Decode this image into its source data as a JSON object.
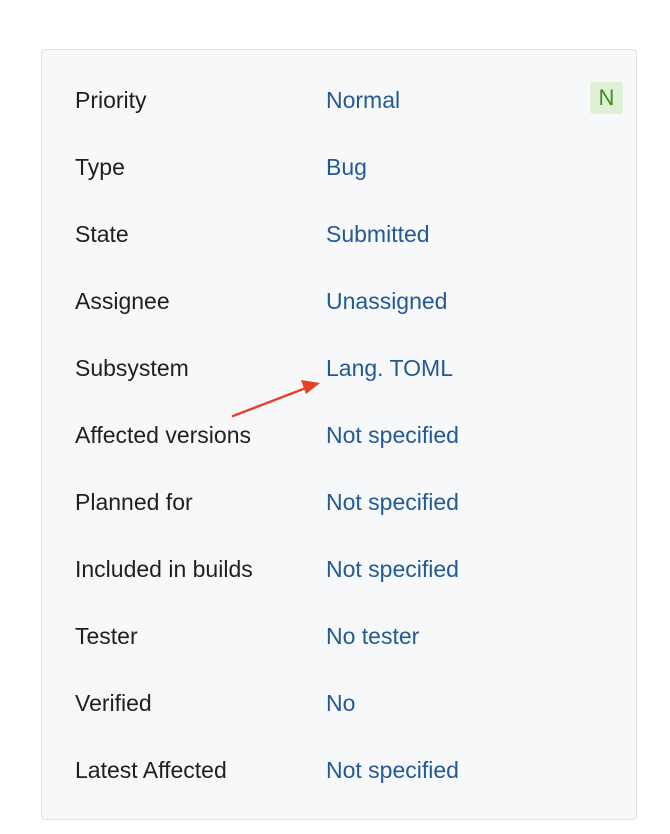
{
  "issue_fields": {
    "priority_badge": "N",
    "rows": [
      {
        "label": "Priority",
        "value": "Normal"
      },
      {
        "label": "Type",
        "value": "Bug"
      },
      {
        "label": "State",
        "value": "Submitted"
      },
      {
        "label": "Assignee",
        "value": "Unassigned"
      },
      {
        "label": "Subsystem",
        "value": "Lang. TOML"
      },
      {
        "label": "Affected versions",
        "value": "Not specified"
      },
      {
        "label": "Planned for",
        "value": "Not specified"
      },
      {
        "label": "Included in builds",
        "value": "Not specified"
      },
      {
        "label": "Tester",
        "value": "No tester"
      },
      {
        "label": "Verified",
        "value": "No"
      },
      {
        "label": "Latest Affected",
        "value": "Not specified"
      }
    ]
  },
  "annotation": {
    "arrow_color": "#e2432a",
    "arrow_target": "Subsystem value"
  },
  "colors": {
    "value_link": "#245a93",
    "label_text": "#1f1f1f",
    "panel_bg": "#f7f8fa",
    "badge_bg": "#dff0d6",
    "badge_text": "#3f8f22"
  }
}
